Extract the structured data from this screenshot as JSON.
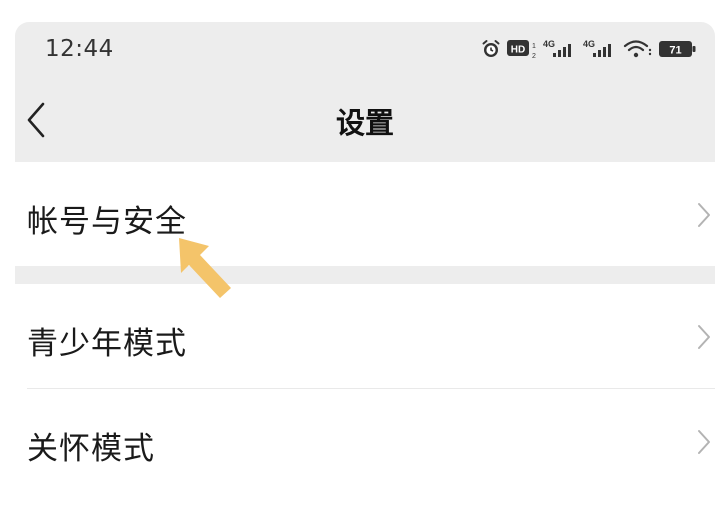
{
  "status": {
    "time": "12:44",
    "icons": [
      "alarm-icon",
      "hd-icon",
      "signal-4g-icon",
      "signal-4g-icon",
      "wifi-icon",
      "battery-icon"
    ],
    "hd": "HD",
    "net1": "4G",
    "net2": "4G",
    "battery": "71"
  },
  "nav": {
    "title": "设置",
    "back_icon": "back-chevron-icon"
  },
  "settings": {
    "items": [
      {
        "label": "帐号与安全"
      },
      {
        "label": "青少年模式"
      },
      {
        "label": "关怀模式"
      }
    ]
  },
  "colors": {
    "background": "#ededed",
    "row": "#ffffff",
    "text": "#1a1a1a",
    "chevron": "#b3b3b3",
    "annotation_arrow": "#f4c46a"
  }
}
